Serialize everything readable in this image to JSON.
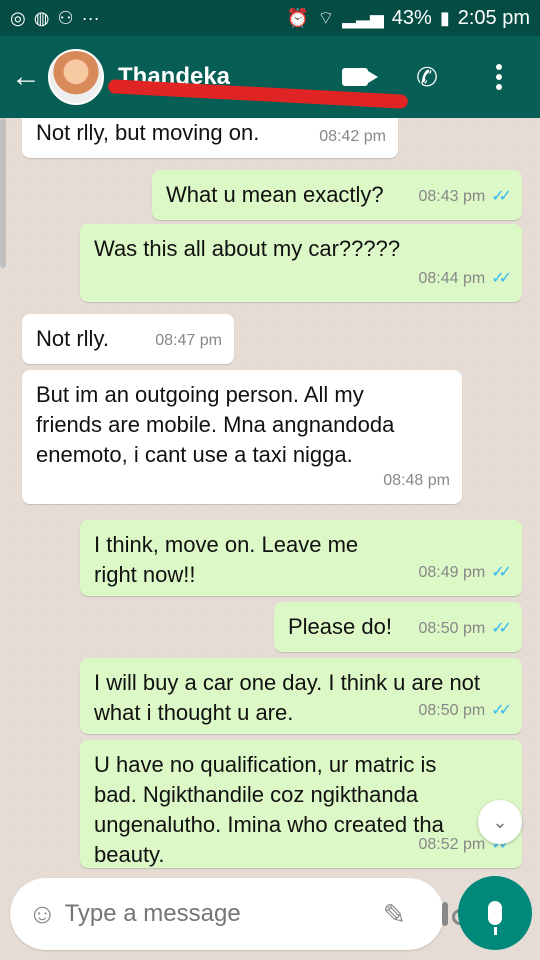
{
  "status": {
    "battery": "43%",
    "time": "2:05 pm",
    "notif_icons": [
      "messenger-icon",
      "whatsapp-icon",
      "add-user-icon",
      "more-icon"
    ]
  },
  "header": {
    "contact_name": "Thandeka",
    "back_icon": "back-arrow-icon",
    "actions": [
      "video-call-icon",
      "voice-call-icon",
      "menu-icon"
    ]
  },
  "messages": [
    {
      "dir": "in",
      "text": "Not rlly, but moving on.",
      "time": "08:42 pm"
    },
    {
      "dir": "out",
      "text": "What u mean exactly?",
      "time": "08:43 pm",
      "read": true
    },
    {
      "dir": "out",
      "text": "Was this all about my car?????",
      "time": "08:44 pm",
      "read": true
    },
    {
      "dir": "in",
      "text": "Not rlly.",
      "time": "08:47 pm"
    },
    {
      "dir": "in",
      "text": "But im an outgoing person. All my friends are mobile. Mna angnandoda enemoto, i cant use a taxi nigga.",
      "time": "08:48 pm"
    },
    {
      "dir": "out",
      "text": "I think, move on. Leave me right now!!",
      "time": "08:49 pm",
      "read": true
    },
    {
      "dir": "out",
      "text": "Please do!",
      "time": "08:50 pm",
      "read": true
    },
    {
      "dir": "out",
      "text": "I will buy a car one day. I think u are not what i thought u are.",
      "time": "08:50 pm",
      "read": true
    },
    {
      "dir": "out",
      "text": "U have no qualification, ur matric is bad. Ngikthandile coz ngikthanda ungenalutho. Imina who created tha beauty.",
      "time": "08:52 pm",
      "read": true
    }
  ],
  "composer": {
    "placeholder": "Type a message"
  },
  "ticks": "✓✓",
  "colors": {
    "header": "#075e54",
    "outgoing": "#dcf8c6",
    "incoming": "#ffffff",
    "read_tick": "#34b7f1",
    "mic": "#00897b"
  }
}
